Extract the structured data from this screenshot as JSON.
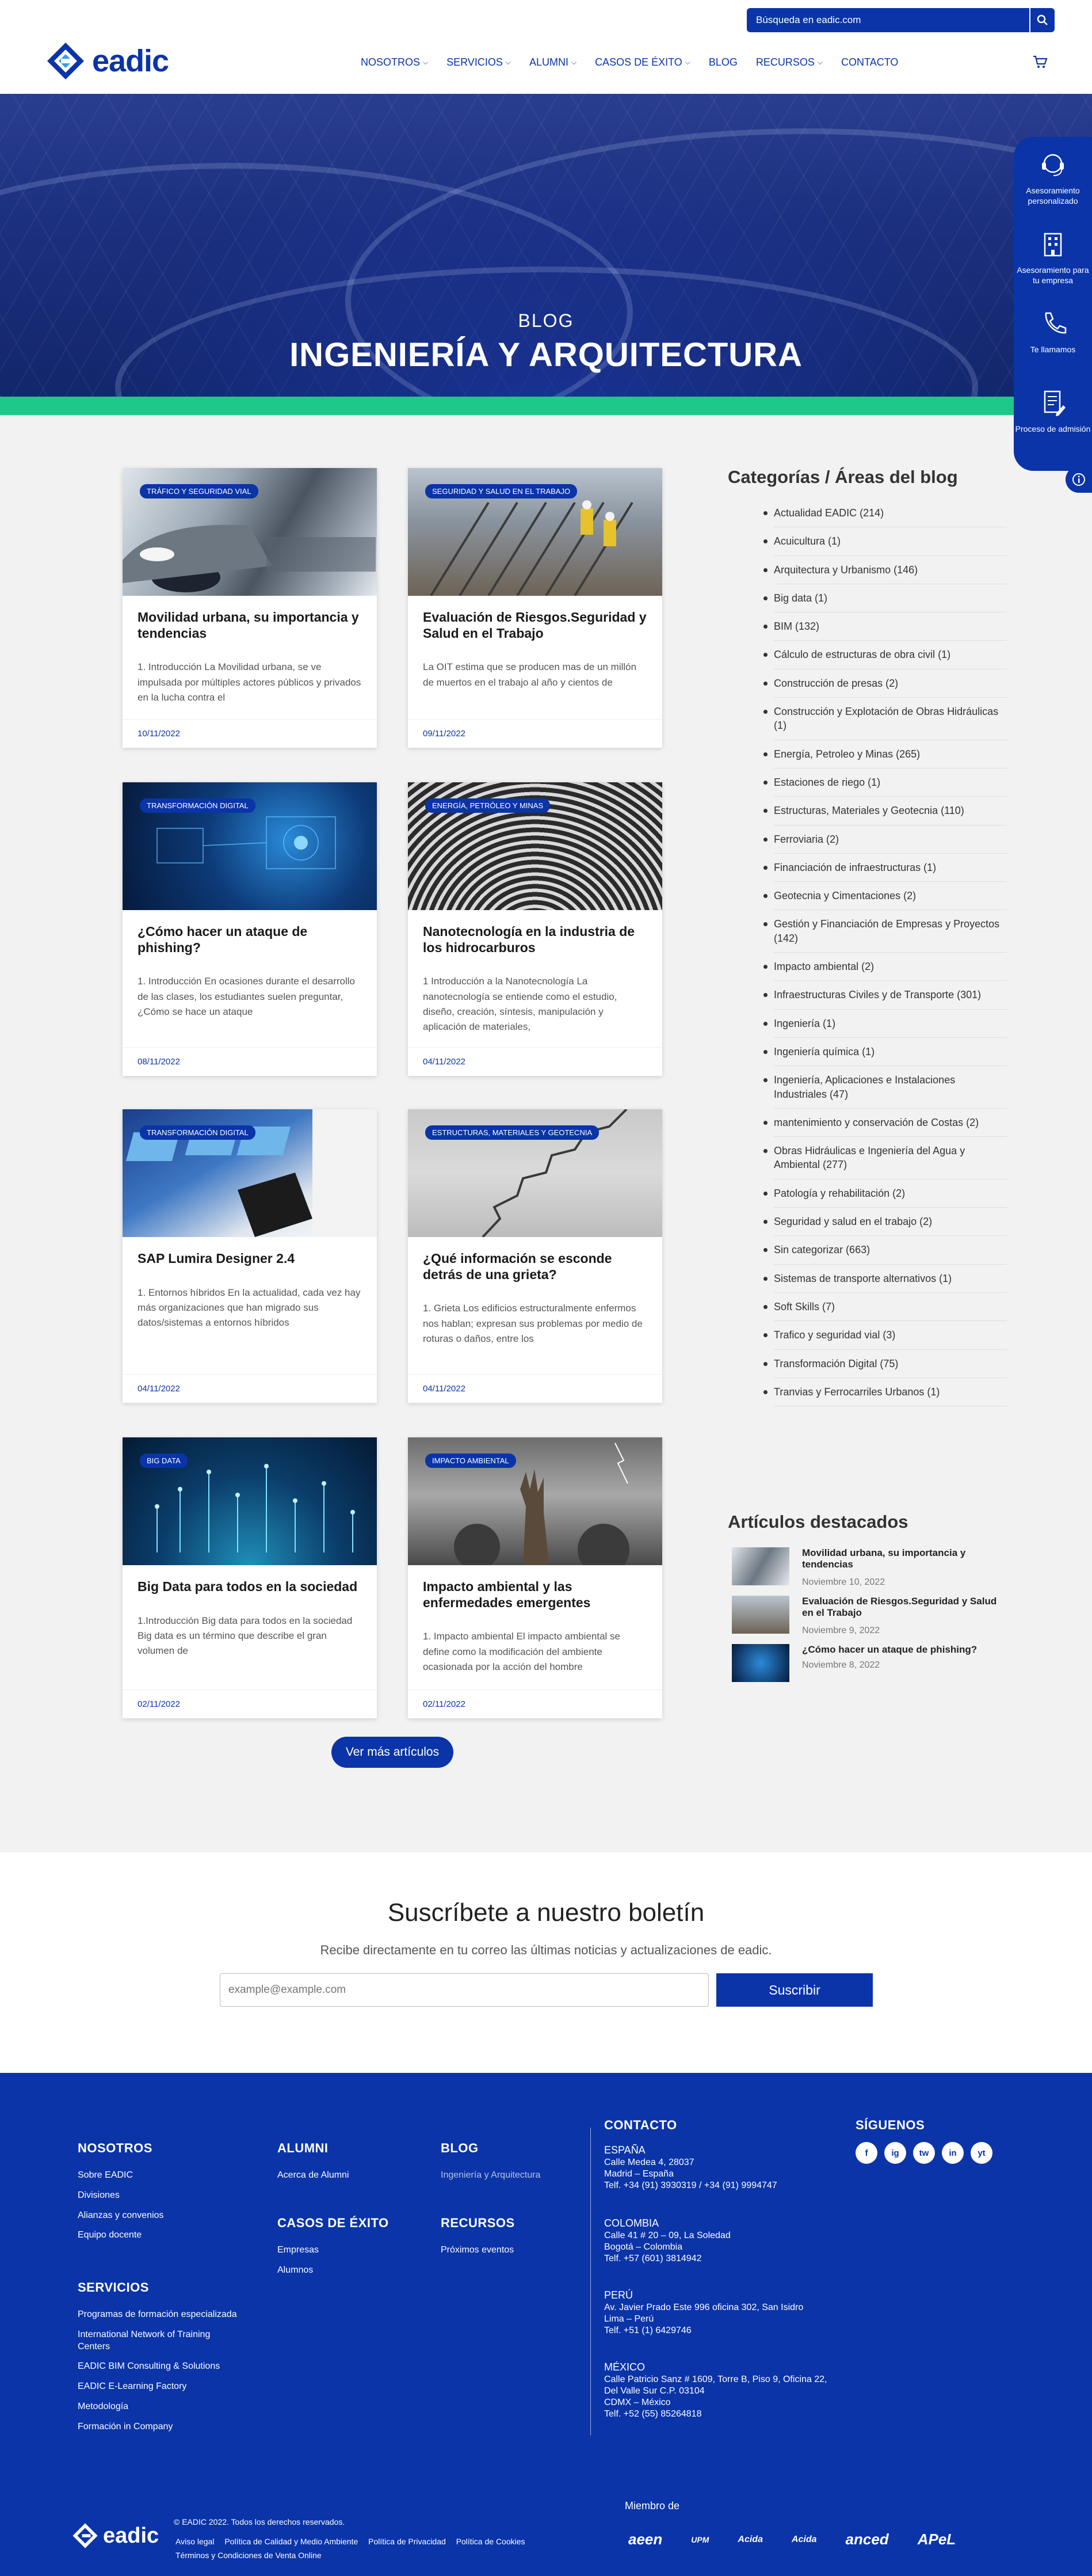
{
  "header": {
    "search_placeholder": "Búsqueda en eadic.com",
    "logo_text": "eadic",
    "nav": [
      {
        "label": "NOSOTROS",
        "dropdown": true
      },
      {
        "label": "SERVICIOS",
        "dropdown": true
      },
      {
        "label": "ALUMNI",
        "dropdown": true
      },
      {
        "label": "CASOS DE ÉXITO",
        "dropdown": true
      },
      {
        "label": "BLOG",
        "dropdown": false
      },
      {
        "label": "RECURSOS",
        "dropdown": true
      },
      {
        "label": "CONTACTO",
        "dropdown": false
      }
    ]
  },
  "hero": {
    "label": "BLOG",
    "title": "INGENIERÍA Y ARQUITECTURA"
  },
  "side_panel": [
    {
      "label": "Asesoramiento personalizado",
      "icon": "headset-icon"
    },
    {
      "label": "Asesoramiento para tu empresa",
      "icon": "building-icon"
    },
    {
      "label": "Te llamamos",
      "icon": "phone-icon"
    },
    {
      "label": "Proceso de admisión",
      "icon": "document-icon"
    }
  ],
  "posts": [
    {
      "tag": "TRÁFICO Y SEGURIDAD VIAL",
      "title": "Movilidad urbana, su importancia y tendencias",
      "excerpt": "1. Introducción   La Movilidad urbana, se ve impulsada por múltiples actores públicos y privados en la lucha contra el",
      "date": "10/11/2022"
    },
    {
      "tag": "SEGURIDAD Y SALUD EN EL TRABAJO",
      "title": "Evaluación de Riesgos.Seguridad y Salud en el Trabajo",
      "excerpt": "La OIT estima que se producen mas de un millón de muertos en el trabajo al año y cientos de",
      "date": "09/11/2022"
    },
    {
      "tag": "TRANSFORMACIÓN DIGITAL",
      "title": "¿Cómo hacer un ataque de phishing?",
      "excerpt": "1. Introducción   En ocasiones durante el desarrollo de las clases, los estudiantes suelen preguntar, ¿Cómo se hace un ataque",
      "date": "08/11/2022"
    },
    {
      "tag": "ENERGÍA, PETRÓLEO Y MINAS",
      "title": "Nanotecnología en la industria de los hidrocarburos",
      "excerpt": "1 Introducción a la Nanotecnología   La nanotecnología se entiende como el estudio, diseño, creación, síntesis, manipulación y aplicación de materiales,",
      "date": "04/11/2022"
    },
    {
      "tag": "TRANSFORMACIÓN DIGITAL",
      "title": "SAP Lumira Designer 2.4",
      "excerpt": "1. Entornos híbridos   En la actualidad, cada vez hay más organizaciones que han migrado sus datos/sistemas a entornos híbridos",
      "date": "04/11/2022"
    },
    {
      "tag": "ESTRUCTURAS, MATERIALES Y GEOTECNIA",
      "title": "¿Qué información se esconde detrás de una grieta?",
      "excerpt": "1. Grieta   Los edificios estructuralmente enfermos nos hablan; expresan sus problemas por medio de roturas o daños, entre los",
      "date": "04/11/2022"
    },
    {
      "tag": "BIG DATA",
      "title": "Big Data para todos en la sociedad",
      "excerpt": "1.Introducción Big data para todos en la sociedad   Big data es un término que describe el gran volumen de",
      "date": "02/11/2022"
    },
    {
      "tag": "IMPACTO AMBIENTAL",
      "title": "Impacto ambiental y las enfermedades emergentes",
      "excerpt": " 1. Impacto ambiental   El impacto ambiental se define como la modificación del ambiente ocasionada por la acción del hombre",
      "date": "02/11/2022"
    }
  ],
  "more_button": "Ver más artículos",
  "sidebar": {
    "categories_title": "Categorías / Áreas del blog",
    "categories": [
      "Actualidad EADIC (214)",
      "Acuicultura (1)",
      "Arquitectura y Urbanismo (146)",
      "Big data (1)",
      "BIM (132)",
      "Cálculo de estructuras de obra civil (1)",
      "Construcción de presas (2)",
      "Construcción y Explotación de Obras Hidráulicas (1)",
      "Energía, Petroleo y Minas (265)",
      "Estaciones de riego (1)",
      "Estructuras, Materiales y Geotecnia (110)",
      "Ferroviaria (2)",
      "Financiación de infraestructuras (1)",
      "Geotecnia y Cimentaciones (2)",
      "Gestión y Financiación de Empresas y Proyectos (142)",
      "Impacto ambiental (2)",
      "Infraestructuras Civiles y de Transporte (301)",
      "Ingeniería (1)",
      "Ingeniería química (1)",
      "Ingeniería, Aplicaciones e Instalaciones Industriales (47)",
      "mantenimiento y conservación de Costas (2)",
      "Obras Hidráulicas e Ingeniería del Agua y Ambiental (277)",
      "Patología y rehabilitación (2)",
      "Seguridad y salud en el trabajo (2)",
      "Sin categorizar (663)",
      "Sistemas de transporte alternativos (1)",
      "Soft Skills (7)",
      "Trafico y seguridad vial (3)",
      "Transformación Digital (75)",
      "Tranvias y Ferrocarriles Urbanos (1)"
    ],
    "featured_title": "Artículos destacados",
    "featured": [
      {
        "title": "Movilidad urbana, su importancia y tendencias",
        "date": "Noviembre 10, 2022"
      },
      {
        "title": "Evaluación de Riesgos.Seguridad y Salud en el Trabajo",
        "date": "Noviembre 9, 2022"
      },
      {
        "title": "¿Cómo hacer un ataque de phishing?",
        "date": "Noviembre 8, 2022"
      }
    ]
  },
  "newsletter": {
    "title": "Suscríbete a nuestro boletín",
    "subtitle": "Recibe directamente en tu correo las últimas noticias y actualizaciones de eadic.",
    "placeholder": "example@example.com",
    "button": "Suscribir"
  },
  "footer": {
    "nosotros": {
      "title": "NOSOTROS",
      "items": [
        "Sobre EADIC",
        "Divisiones",
        "Alianzas y convenios",
        "Equipo docente"
      ]
    },
    "servicios": {
      "title": "SERVICIOS",
      "items": [
        "Programas de formación especializada",
        "International Network of Training Centers",
        "EADIC BIM Consulting & Solutions",
        "EADIC E-Learning Factory",
        "Metodología",
        "Formación in Company"
      ]
    },
    "alumni": {
      "title": "ALUMNI",
      "items": [
        "Acerca de Alumni"
      ]
    },
    "casos": {
      "title": "CASOS DE ÉXITO",
      "items": [
        "Empresas",
        "Alumnos"
      ]
    },
    "blog": {
      "title": "BLOG",
      "items": [
        "Ingeniería y Arquitectura"
      ]
    },
    "recursos": {
      "title": "RECURSOS",
      "items": [
        "Próximos eventos"
      ]
    },
    "contacto": {
      "title": "CONTACTO",
      "countries": [
        {
          "name": "ESPAÑA",
          "lines": [
            "Calle Medea 4, 28037",
            "Madrid – España",
            "Telf. +34 (91) 3930319 / +34 (91) 9994747"
          ]
        },
        {
          "name": "COLOMBIA",
          "lines": [
            "Calle 41 # 20 – 09, La Soledad",
            "Bogotá – Colombia",
            "Telf. +57 (601) 3814942"
          ]
        },
        {
          "name": "PERÚ",
          "lines": [
            "Av. Javier Prado Este 996 oficina 302, San Isidro",
            "Lima – Perú",
            "Telf. +51 (1) 6429746"
          ]
        },
        {
          "name": "MÉXICO",
          "lines": [
            "Calle Patricio Sanz # 1609, Torre B, Piso 9, Oficina 22,",
            "Del Valle Sur C.P. 03104",
            "CDMX – México",
            "Telf. +52 (55) 85264818"
          ]
        }
      ]
    },
    "social_title": "SÍGUENOS",
    "social": [
      "f",
      "ig",
      "tw",
      "in",
      "yt"
    ],
    "logo_text": "eadic",
    "copyright": "© EADIC 2022. Todos los derechos reservados.",
    "legal": [
      "Aviso legal",
      "Política de Calidad y Medio Ambiente",
      "Política de Privacidad",
      "Política de Cookies",
      "Términos y Condiciones de Venta Online"
    ],
    "member_label": "Miembro de",
    "partners": [
      "aeen",
      "UPM",
      "Acida",
      "Acida",
      "anced",
      "APeL"
    ]
  }
}
